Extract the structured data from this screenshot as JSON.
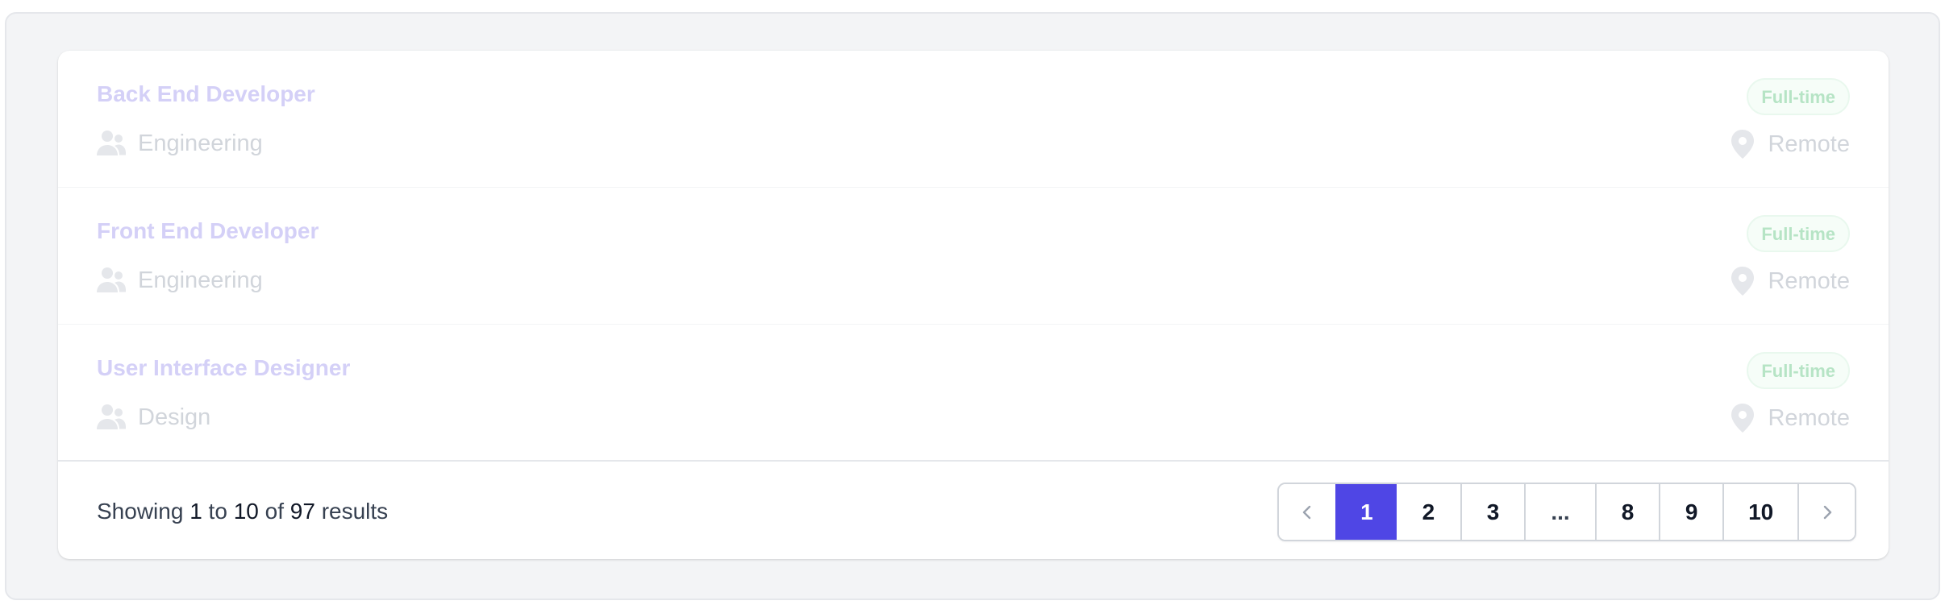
{
  "jobs": [
    {
      "title": "Back End Developer",
      "type": "Full-time",
      "department": "Engineering",
      "location": "Remote"
    },
    {
      "title": "Front End Developer",
      "type": "Full-time",
      "department": "Engineering",
      "location": "Remote"
    },
    {
      "title": "User Interface Designer",
      "type": "Full-time",
      "department": "Design",
      "location": "Remote"
    }
  ],
  "icons": {
    "department": "users-icon",
    "location": "map-pin-icon",
    "previous": "chevron-left-icon",
    "next": "chevron-right-icon"
  },
  "colors": {
    "accent": "#4f46e5",
    "title": "#d4d0f7",
    "badge_text": "#b6e4c5",
    "muted": "#d1d5db"
  },
  "pagination": {
    "summary_prefix": "Showing",
    "from": "1",
    "to_word": "to",
    "to": "10",
    "of_word": "of",
    "total": "97",
    "suffix": "results",
    "current_page": "1",
    "pages": [
      "1",
      "2",
      "3",
      "...",
      "8",
      "9",
      "10"
    ]
  }
}
